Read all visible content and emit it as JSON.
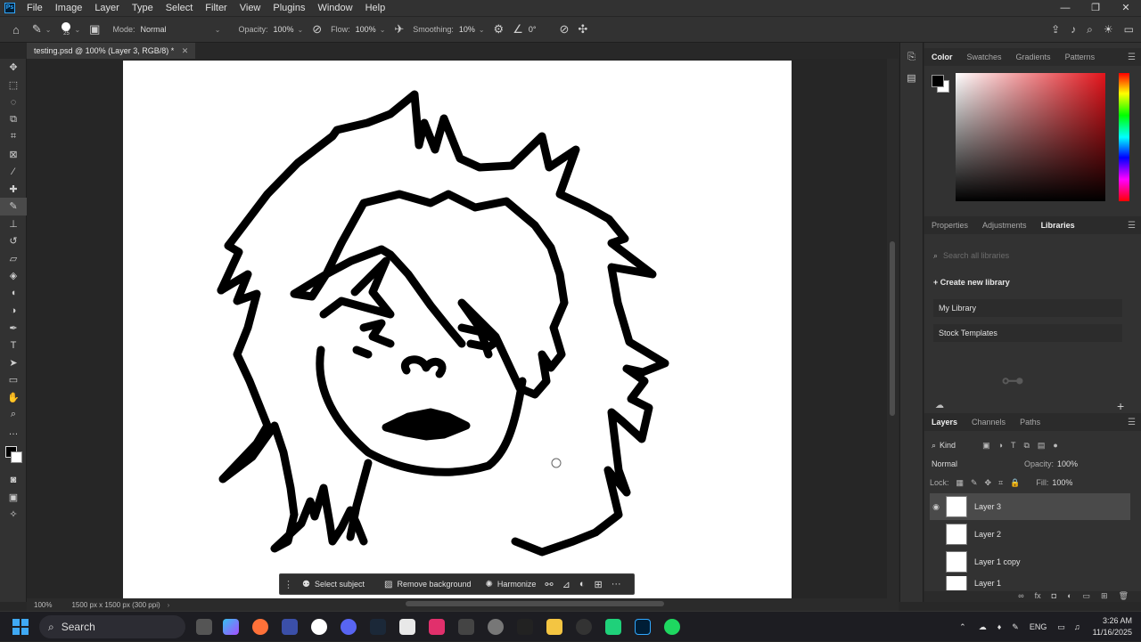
{
  "menubar": {
    "logo": "Ps",
    "items": [
      "File",
      "Image",
      "Layer",
      "Type",
      "Select",
      "Filter",
      "View",
      "Plugins",
      "Window",
      "Help"
    ]
  },
  "options": {
    "brush_size": "25",
    "mode_label": "Mode:",
    "mode_value": "Normal",
    "opacity_label": "Opacity:",
    "opacity_value": "100%",
    "flow_label": "Flow:",
    "flow_value": "100%",
    "smoothing_label": "Smoothing:",
    "smoothing_value": "10%",
    "angle_value": "0°"
  },
  "document": {
    "tab_title": "testing.psd @ 100% (Layer 3, RGB/8) *",
    "zoom": "100%",
    "doc_info": "1500 px x 1500 px (300 ppi)"
  },
  "contextual_bar": {
    "select_subject": "Select subject",
    "remove_background": "Remove background",
    "harmonize": "Harmonize"
  },
  "color_panel": {
    "tabs": [
      "Color",
      "Swatches",
      "Gradients",
      "Patterns"
    ],
    "active_tab": "Color",
    "foreground": "#000000",
    "background": "#ffffff",
    "hue_color": "#e3141b"
  },
  "libraries_panel": {
    "tabs": [
      "Properties",
      "Adjustments",
      "Libraries"
    ],
    "active_tab": "Libraries",
    "search_placeholder": "Search all libraries",
    "create_label": "Create new library",
    "items": [
      "My Library",
      "Stock Templates"
    ]
  },
  "layers_panel": {
    "tabs": [
      "Layers",
      "Channels",
      "Paths"
    ],
    "active_tab": "Layers",
    "filter_label": "Kind",
    "blend_mode": "Normal",
    "opacity_label": "Opacity:",
    "opacity_value": "100%",
    "lock_label": "Lock:",
    "fill_label": "Fill:",
    "fill_value": "100%",
    "layers": [
      {
        "name": "Layer 3",
        "visible": true,
        "selected": true
      },
      {
        "name": "Layer 2",
        "visible": false,
        "selected": false
      },
      {
        "name": "Layer 1 copy",
        "visible": false,
        "selected": false
      },
      {
        "name": "Layer 1",
        "visible": false,
        "selected": false
      }
    ]
  },
  "taskbar": {
    "search_label": "Search",
    "language": "ENG",
    "time": "3:26 AM",
    "date": "11/16/2025"
  }
}
